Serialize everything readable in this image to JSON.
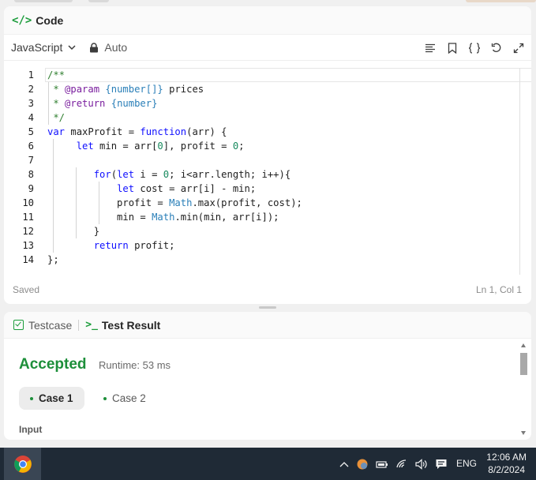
{
  "code_panel": {
    "title": "Code",
    "language": "JavaScript",
    "mode": "Auto",
    "status_saved": "Saved",
    "cursor_position": "Ln 1, Col 1",
    "toolbar_icons": [
      "format-icon",
      "bookmark-icon",
      "braces-icon",
      "reset-icon",
      "expand-icon"
    ]
  },
  "editor": {
    "line_numbers": [
      "1",
      "2",
      "3",
      "4",
      "5",
      "6",
      "7",
      "8",
      "9",
      "10",
      "11",
      "12",
      "13",
      "14"
    ]
  },
  "result_panel": {
    "tab_testcase": "Testcase",
    "tab_result": "Test Result",
    "verdict": "Accepted",
    "runtime": "Runtime: 53 ms",
    "case1": "Case 1",
    "case2": "Case 2",
    "input_label": "Input"
  },
  "taskbar": {
    "language": "ENG",
    "time": "12:06 AM",
    "date": "8/2/2024"
  },
  "colors": {
    "accent_green": "#1d8f3a",
    "taskbar": "#1f2a36"
  }
}
